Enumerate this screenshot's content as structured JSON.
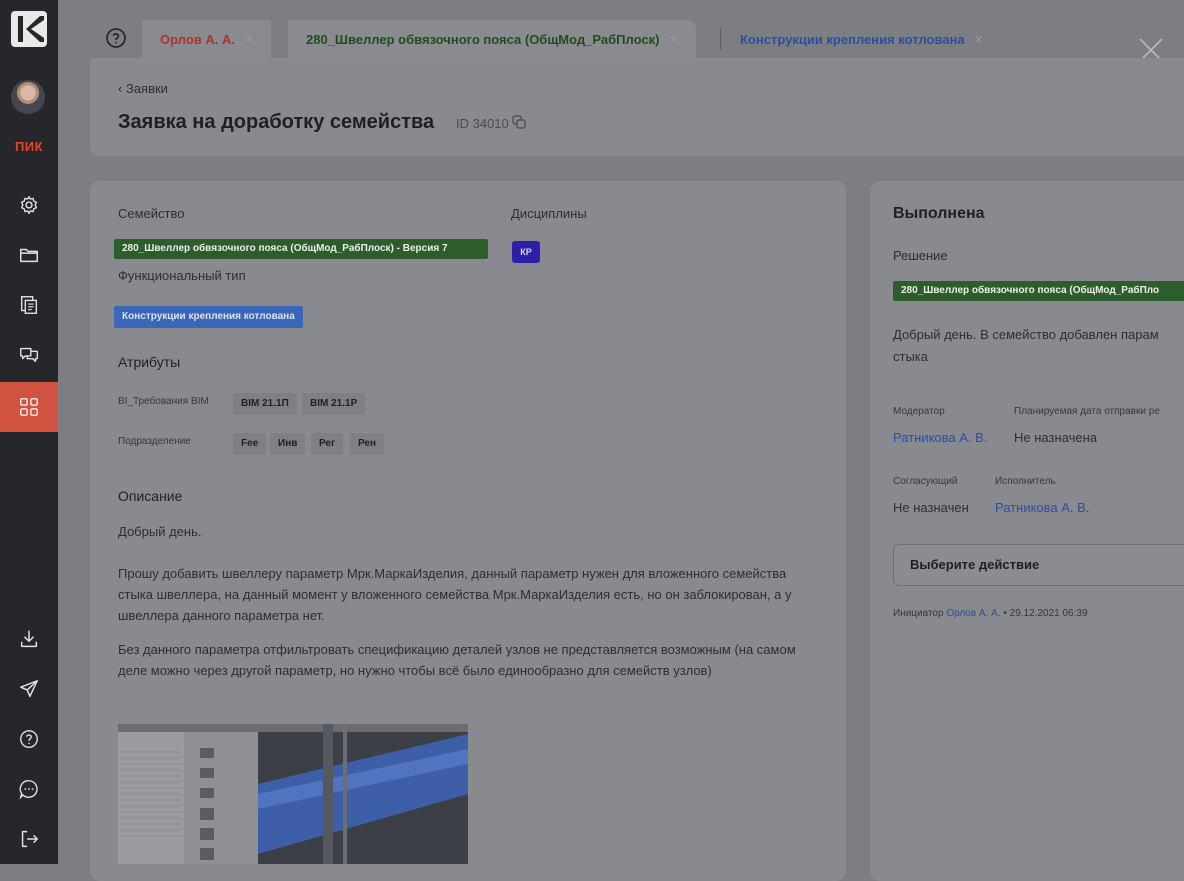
{
  "sidebar": {
    "brand": "ПИК",
    "items": [
      {
        "icon": "settings-icon"
      },
      {
        "icon": "folder-icon"
      },
      {
        "icon": "document-list-icon"
      },
      {
        "icon": "chat-icon"
      },
      {
        "icon": "grid-icon",
        "active": true
      },
      {
        "icon": "download-icon"
      },
      {
        "icon": "send-icon"
      },
      {
        "icon": "help-icon"
      },
      {
        "icon": "message-icon"
      },
      {
        "icon": "logout-icon"
      }
    ]
  },
  "tabs": {
    "help_icon": "?",
    "items": [
      {
        "label": "Орлов А. А."
      },
      {
        "label": "280_Швеллер обвязочного пояса (ОбщМод_РабПлоск)"
      },
      {
        "label": "Конструкции крепления котлована"
      }
    ],
    "close_glyph": "×"
  },
  "header": {
    "back_label": "Заявки",
    "title": "Заявка на доработку семейства",
    "id_label": "ID 34010"
  },
  "main": {
    "family_label": "Семейство",
    "family_chip": "280_Швеллер обвязочного пояса (ОбщМод_РабПлоск) - Версия 7",
    "disciplines_label": "Дисциплины",
    "discipline_chip": "КР",
    "func_type_label": "Функциональный тип",
    "func_type_chip": "Конструкции крепления котлована",
    "attributes_label": "Атрибуты",
    "attr_rows": [
      {
        "name": "BI_Требования BIM",
        "values": [
          "BIM 21.1П",
          "BIM 21.1Р"
        ]
      },
      {
        "name": "Подразделение",
        "values": [
          "Fee",
          "Инв",
          "Рег",
          "Рен"
        ]
      }
    ],
    "description_label": "Описание",
    "description_paragraphs": [
      "Добрый день.",
      "Прошу добавить швеллеру параметр Мрк.МаркаИзделия, данный параметр нужен для вложенного семейства стыка швеллера, на данный момент у вложенного семейства Мрк.МаркаИзделия есть, но он заблокирован, а у швеллера данного параметра нет.",
      "Без данного параметра отфильтровать спецификацию деталей узлов не представляется возможным (на самом деле можно через другой параметр, но нужно чтобы всё было единообразно для семейств узлов)"
    ]
  },
  "side": {
    "status": "Выполнена",
    "solution_label": "Решение",
    "solution_chip": "280_Швеллер обвязочного пояса (ОбщМод_РабПло",
    "solution_text_1": "Добрый день. В семейство добавлен парам",
    "solution_text_2": "стыка",
    "moderator_label": "Модератор",
    "moderator_value": "Ратникова А. В.",
    "planned_date_label": "Планируемая дата отправки ре",
    "planned_date_value": "Не назначена",
    "approver_label": "Согласующий",
    "approver_value": "Не назначен",
    "executor_label": "Исполнитель",
    "executor_value": "Ратникова А. В.",
    "action_placeholder": "Выберите действие",
    "initiator_prefix": "Инициатор",
    "initiator_name": "Орлов А. А.",
    "initiator_date": "• 29.12.2021 06:39"
  }
}
